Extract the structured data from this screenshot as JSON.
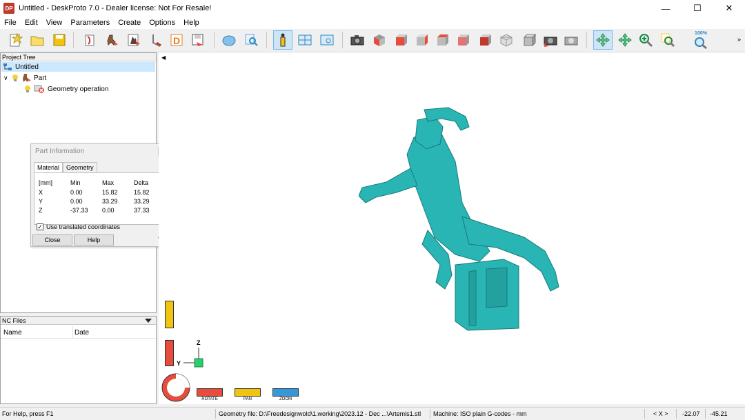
{
  "window": {
    "app_icon_text": "DP",
    "title": "Untitled - DeskProto 7.0 - Dealer license: Not For Resale!"
  },
  "menu": [
    "File",
    "Edit",
    "View",
    "Parameters",
    "Create",
    "Options",
    "Help"
  ],
  "toolbar": {
    "zoom_label": "100%"
  },
  "project_tree": {
    "header": "Project Tree",
    "items": [
      {
        "label": "Untitled"
      },
      {
        "label": "Part"
      },
      {
        "label": "Geometry operation"
      }
    ]
  },
  "part_info": {
    "title": "Part Information",
    "tabs": [
      "Material",
      "Geometry"
    ],
    "headers": [
      "[mm]",
      "Min",
      "Max",
      "Delta"
    ],
    "rows": [
      [
        "X",
        "0.00",
        "15.82",
        "15.82"
      ],
      [
        "Y",
        "0.00",
        "33.29",
        "33.29"
      ],
      [
        "Z",
        "-37.33",
        "0.00",
        "37.33"
      ]
    ],
    "checkbox_label": "Use translated coordinates",
    "close_label": "Close",
    "help_label": "Help"
  },
  "nc_files": {
    "header": "NC Files",
    "columns": [
      "Name",
      "Date"
    ]
  },
  "viewport": {
    "axis_z": "Z",
    "axis_y": "Y",
    "mouse_buttons": [
      "ROTATE",
      "PAN",
      "ZOOM"
    ],
    "model_color": "#2ab5b5"
  },
  "status": {
    "help": "For Help, press F1",
    "geometry": "Geometry file: D:\\Freedesignwold\\1.working\\2023.12 - Dec ...\\Artemis1.stl",
    "machine": "Machine: ISO plain G-codes - mm",
    "coord_label": "< X >",
    "x": "-22.07",
    "y": "-45.21"
  }
}
